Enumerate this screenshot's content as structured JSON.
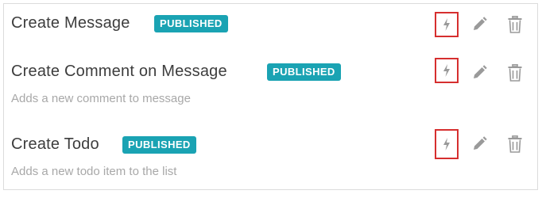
{
  "actions": [
    {
      "title": "Create Message",
      "status": "PUBLISHED",
      "description": ""
    },
    {
      "title": "Create Comment on Message",
      "status": "PUBLISHED",
      "description": "Adds a new comment to message"
    },
    {
      "title": "Create Todo",
      "status": "PUBLISHED",
      "description": "Adds a new todo item to the list"
    }
  ],
  "icons": {
    "trigger": "lightning-bolt-icon",
    "edit": "pencil-icon",
    "delete": "trash-icon"
  },
  "colors": {
    "badge": "#1aa3b3",
    "title": "#3d3d3d",
    "description": "#a8a8a8",
    "icon": "#9a9a9a",
    "highlight_border": "#d62f2f"
  }
}
